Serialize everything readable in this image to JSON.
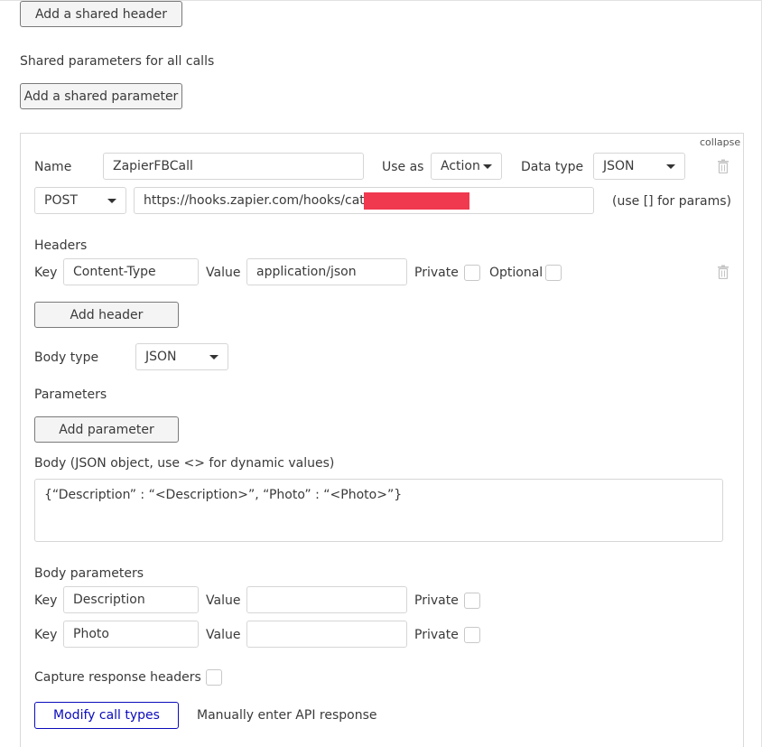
{
  "top": {
    "add_shared_header": "Add a shared header",
    "shared_params_label": "Shared parameters for all calls",
    "add_shared_param": "Add a shared parameter"
  },
  "call": {
    "collapse": "collapse",
    "name_label": "Name",
    "name_value": "ZapierFBCall",
    "use_as_label": "Use as",
    "use_as_value": "Action",
    "data_type_label": "Data type",
    "data_type_value": "JSON",
    "method_value": "POST",
    "url_value": "https://hooks.zapier.com/hooks/catch/",
    "url_hint": "(use [] for params)",
    "headers_label": "Headers",
    "header": {
      "key_label": "Key",
      "key_value": "Content-Type",
      "value_label": "Value",
      "value_value": "application/json",
      "private_label": "Private",
      "optional_label": "Optional"
    },
    "add_header": "Add header",
    "body_type_label": "Body type",
    "body_type_value": "JSON",
    "parameters_label": "Parameters",
    "add_parameter": "Add parameter",
    "body_label": "Body (JSON object, use <> for dynamic values)",
    "body_value": "{“Description” : “<Description>”, “Photo” : “<Photo>”}",
    "body_params_label": "Body parameters",
    "body_params": [
      {
        "key_label": "Key",
        "key_value": "Description",
        "value_label": "Value",
        "value_value": "",
        "private_label": "Private"
      },
      {
        "key_label": "Key",
        "key_value": "Photo",
        "value_label": "Value",
        "value_value": "",
        "private_label": "Private"
      }
    ],
    "capture_label": "Capture response headers",
    "modify_call_types": "Modify call types",
    "manual_response": "Manually enter API response"
  },
  "colors": {
    "primary": "#0b0bbd",
    "redaction": "#f0394f",
    "border": "#d6d6d6"
  }
}
